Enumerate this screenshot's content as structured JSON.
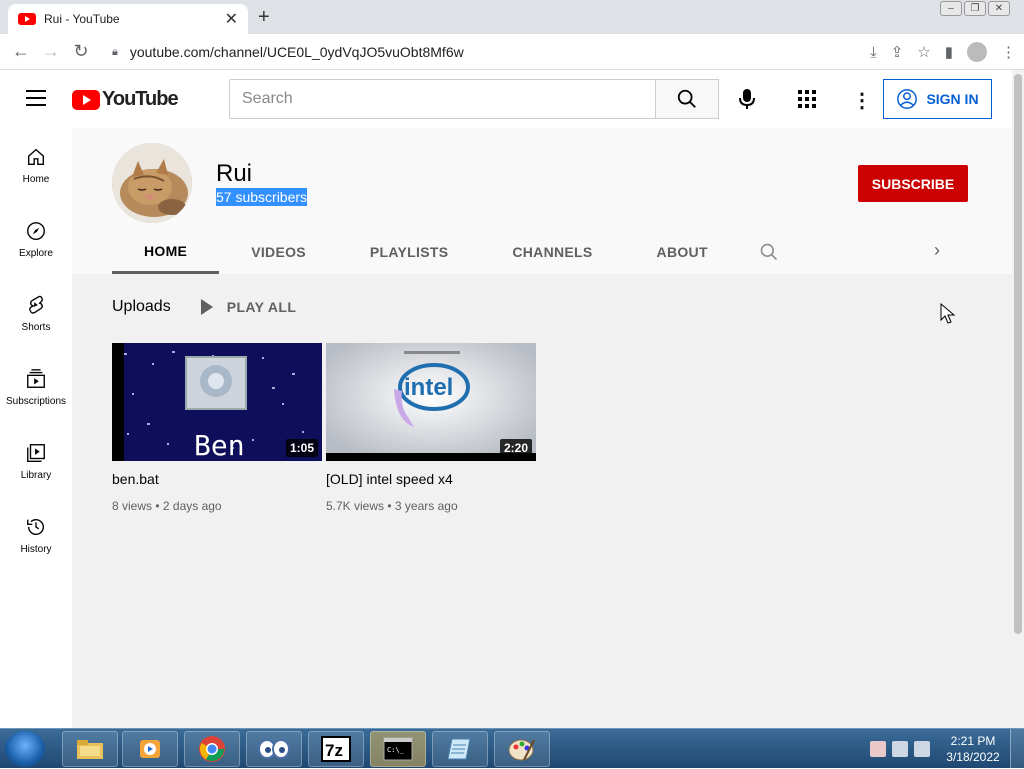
{
  "browser": {
    "tab_title": "Rui - YouTube",
    "url": "youtube.com/channel/UCE0L_0ydVqJO5vuObt8Mf6w"
  },
  "header": {
    "logo_text": "YouTube",
    "search_placeholder": "Search",
    "signin_label": "SIGN IN"
  },
  "sidebar": {
    "items": [
      {
        "label": "Home",
        "icon": "home-icon"
      },
      {
        "label": "Explore",
        "icon": "compass-icon"
      },
      {
        "label": "Shorts",
        "icon": "shorts-icon"
      },
      {
        "label": "Subscriptions",
        "icon": "subscriptions-icon"
      },
      {
        "label": "Library",
        "icon": "library-icon"
      },
      {
        "label": "History",
        "icon": "history-icon"
      }
    ]
  },
  "channel": {
    "name": "Rui",
    "subscribers": "57 subscribers",
    "subscribe_label": "SUBSCRIBE",
    "tabs": [
      "HOME",
      "VIDEOS",
      "PLAYLISTS",
      "CHANNELS",
      "ABOUT"
    ],
    "active_tab": "HOME"
  },
  "uploads": {
    "title": "Uploads",
    "play_all": "PLAY ALL",
    "videos": [
      {
        "title": "ben.bat",
        "views": "8 views",
        "age": "2 days ago",
        "duration": "1:05",
        "thumb_text": "Ben"
      },
      {
        "title": "[OLD] intel speed x4",
        "views": "5.7K views",
        "age": "3 years ago",
        "duration": "2:20",
        "thumb_text": "intel"
      }
    ]
  },
  "taskbar": {
    "time": "2:21 PM",
    "date": "3/18/2022"
  },
  "colors": {
    "accent": "#065fd4",
    "subscribe": "#cc0000",
    "brand": "#ff0000"
  }
}
